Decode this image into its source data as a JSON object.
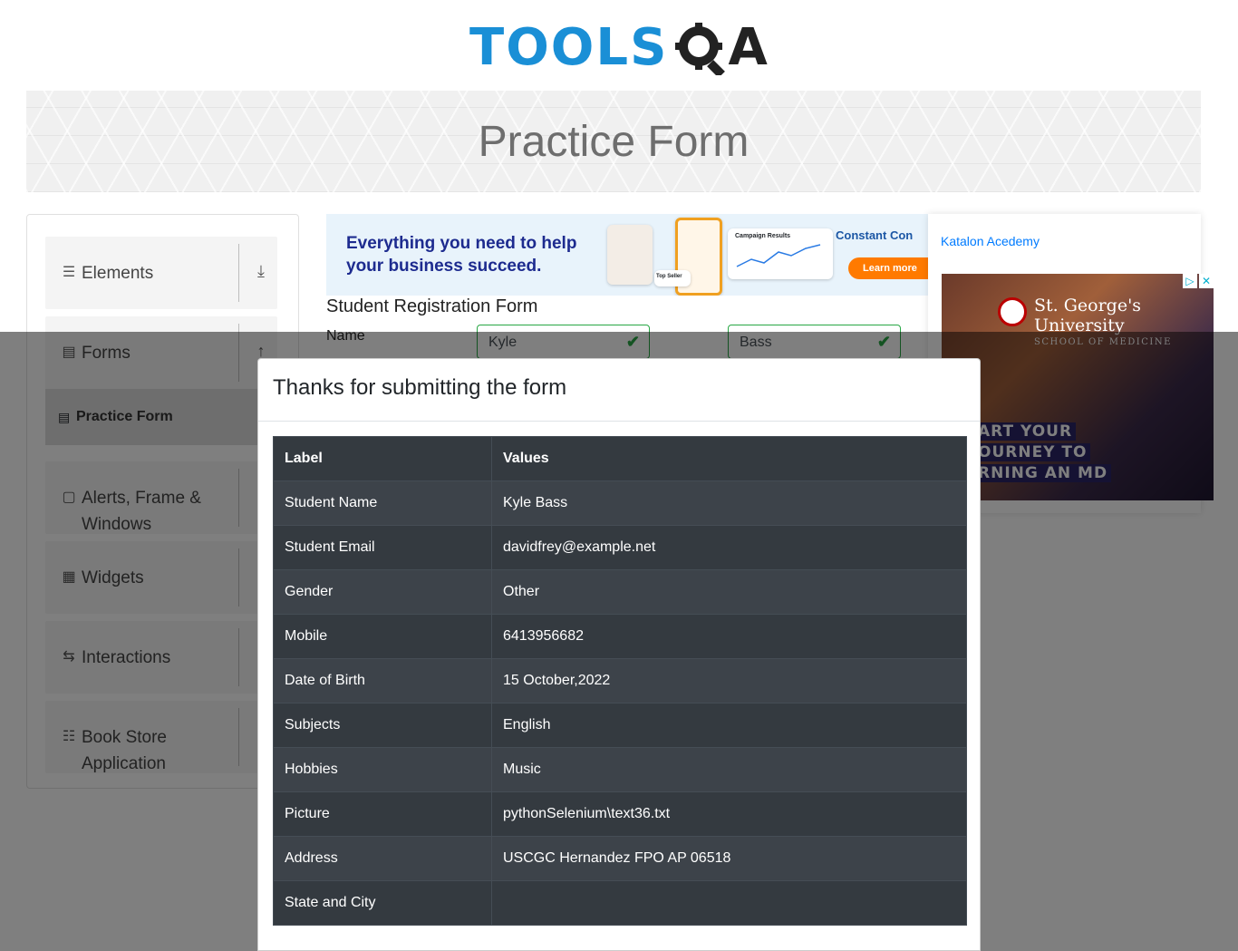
{
  "header": {
    "logo_tools": "TOOLS",
    "logo_qa": "A",
    "page_title": "Practice Form"
  },
  "sidebar": {
    "groups": [
      {
        "title": "Elements",
        "icon": "bars-icon",
        "toggle": "download-arrow-icon"
      },
      {
        "title": "Forms",
        "icon": "document-icon",
        "toggle": "up-arrow-icon"
      },
      {
        "title": "Alerts, Frame & Windows",
        "icon": "window-icon"
      },
      {
        "title": "Widgets",
        "icon": "widgets-icon"
      },
      {
        "title": "Interactions",
        "icon": "interactions-icon"
      },
      {
        "title": "Book Store Application",
        "icon": "books-icon"
      }
    ],
    "forms_items": [
      {
        "label": "Practice Form",
        "icon": "form-icon"
      }
    ]
  },
  "ad": {
    "headline_line1": "Everything you need to help",
    "headline_line2": "your business succeed.",
    "campaign_results": "Campaign Results",
    "top_seller": "Top Seller",
    "brand": "Constant Con",
    "cta": "Learn more"
  },
  "form": {
    "title": "Student Registration Form",
    "name_label": "Name",
    "first_name": "Kyle",
    "last_name": "Bass"
  },
  "right_panel": {
    "link": "Katalon Acedemy",
    "ad_school": "St. George's University",
    "ad_school_sub": "SCHOOL OF MEDICINE",
    "ad_line1": "ART YOUR",
    "ad_line2": "OURNEY TO",
    "ad_line3": "RNING AN MD"
  },
  "modal": {
    "title": "Thanks for submitting the form",
    "columns": [
      "Label",
      "Values"
    ],
    "rows": [
      {
        "label": "Student Name",
        "value": "Kyle Bass"
      },
      {
        "label": "Student Email",
        "value": "davidfrey@example.net"
      },
      {
        "label": "Gender",
        "value": "Other"
      },
      {
        "label": "Mobile",
        "value": "6413956682"
      },
      {
        "label": "Date of Birth",
        "value": "15 October,2022"
      },
      {
        "label": "Subjects",
        "value": "English"
      },
      {
        "label": "Hobbies",
        "value": "Music"
      },
      {
        "label": "Picture",
        "value": "pythonSelenium\\text36.txt"
      },
      {
        "label": "Address",
        "value": "USCGC Hernandez FPO AP 06518"
      },
      {
        "label": "State and City",
        "value": ""
      }
    ]
  },
  "colors": {
    "brand_blue": "#1a8fd6",
    "valid_green": "#28a745",
    "table_dark": "#343a40",
    "link_blue": "#007bff"
  }
}
